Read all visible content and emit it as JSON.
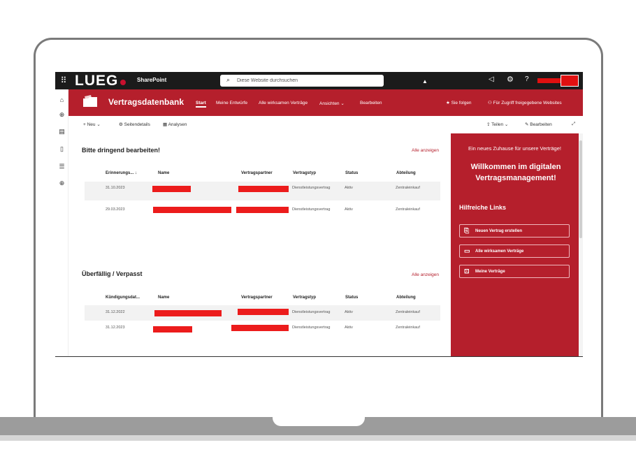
{
  "suite": {
    "logo_text": "LUEG",
    "app_name": "SharePoint",
    "search_placeholder": "Diese Website durchsuchen"
  },
  "site": {
    "title": "Vertragsdatenbank",
    "nav": [
      "Start",
      "Meine Entwürfe",
      "Alle wirksamen Verträge",
      "Ansichten ⌄",
      "Bearbeiten"
    ],
    "follow_label": "Sie folgen",
    "access_label": "Für Zugriff freigegebene Websites"
  },
  "commands": {
    "new": "Neu",
    "page_details": "Seitendetails",
    "analytics": "Analysen",
    "share": "Teilen",
    "edit": "Bearbeiten"
  },
  "sections": [
    {
      "title": "Bitte dringend bearbeiten!",
      "see_all": "Alle anzeigen",
      "columns": [
        "Erinnerungs... ↓",
        "Name",
        "Vertragspartner",
        "Vertragstyp",
        "Status",
        "Abteilung"
      ],
      "rows": [
        {
          "date": "31.10.2023",
          "type": "Dienstleistungsvertrag",
          "status": "Aktiv",
          "department": "Zentraleinkauf"
        },
        {
          "date": "29.03.2023",
          "type": "Dienstleistungsvertrag",
          "status": "Aktiv",
          "department": "Zentraleinkauf"
        }
      ]
    },
    {
      "title": "Überfällig / Verpasst",
      "see_all": "Alle anzeigen",
      "columns": [
        "Kündigungsdat...",
        "Name",
        "Vertragspartner",
        "Vertragstyp",
        "Status",
        "Abteilung"
      ],
      "rows": [
        {
          "date": "31.12.2022",
          "type": "Dienstleistungsvertrag",
          "status": "Aktiv",
          "department": "Zentraleinkauf"
        },
        {
          "date": "31.12.2023",
          "type": "Dienstleistungsvertrag",
          "status": "Aktiv",
          "department": "Zentraleinkauf"
        }
      ]
    }
  ],
  "panel": {
    "intro": "Ein neues Zuhause für unsere Verträge!",
    "heading": "Willkommen im digitalen Vertragsmanagement!",
    "links_heading": "Hilfreiche Links",
    "links": [
      "Neuen Vertrag erstellen",
      "Alle wirksamen Verträge",
      "Meine Verträge"
    ]
  },
  "colors": {
    "brand_red": "#b51f2c",
    "suite_bar": "#1b1b1b",
    "redaction": "#ec1c1c"
  }
}
